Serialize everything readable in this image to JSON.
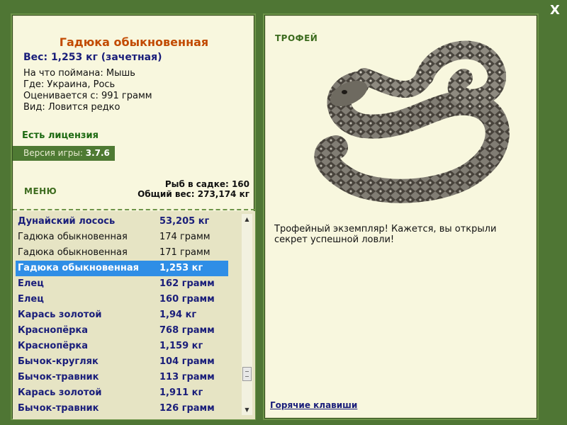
{
  "close_label": "X",
  "fish": {
    "title": "Гадюка обыкновенная",
    "weight_line": "Вес: 1,253 кг (зачетная)",
    "bait": "На что поймана: Мышь",
    "location": "Где: Украина, Рось",
    "rated_from": "Оценивается с: 991 грамм",
    "species_rarity": "Вид: Ловится редко"
  },
  "license": "Есть лицензия",
  "version": {
    "label": "Версия игры:",
    "value": "3.7.6"
  },
  "menu_label": "МЕНЮ",
  "creel": {
    "count_line": "Рыб в садке: 160",
    "total_line": "Общий вес: 273,174 кг"
  },
  "catch_list": [
    {
      "name": "Дунайский лосось",
      "weight": "53,205 кг",
      "style": "bold"
    },
    {
      "name": "Гадюка обыкновенная",
      "weight": "174 грамм",
      "style": "normal"
    },
    {
      "name": "Гадюка обыкновенная",
      "weight": "171 грамм",
      "style": "normal"
    },
    {
      "name": "Гадюка обыкновенная",
      "weight": "1,253 кг",
      "style": "selected"
    },
    {
      "name": "Елец",
      "weight": "162 грамм",
      "style": "bold"
    },
    {
      "name": "Елец",
      "weight": "160 грамм",
      "style": "bold"
    },
    {
      "name": "Карась золотой",
      "weight": "1,94 кг",
      "style": "bold"
    },
    {
      "name": "Краснопёрка",
      "weight": "768 грамм",
      "style": "bold"
    },
    {
      "name": "Краснопёрка",
      "weight": "1,159 кг",
      "style": "bold"
    },
    {
      "name": "Бычок-кругляк",
      "weight": "104 грамм",
      "style": "bold"
    },
    {
      "name": "Бычок-травник",
      "weight": "113 грамм",
      "style": "bold"
    },
    {
      "name": "Карась золотой",
      "weight": "1,911 кг",
      "style": "bold"
    },
    {
      "name": "Бычок-травник",
      "weight": "126 грамм",
      "style": "bold"
    }
  ],
  "trophy": {
    "label": "ТРОФЕЙ",
    "text": "Трофейный экземпляр! Кажется, вы открыли секрет успешной ловли!"
  },
  "hotkeys_label": "Горячие клавиши",
  "colors": {
    "background": "#4f7634",
    "panel": "#f8f7de",
    "title": "#c24a00",
    "accent_blue": "#1a1e7a",
    "selection": "#2f8ee6",
    "green_text": "#3c6b1e"
  }
}
